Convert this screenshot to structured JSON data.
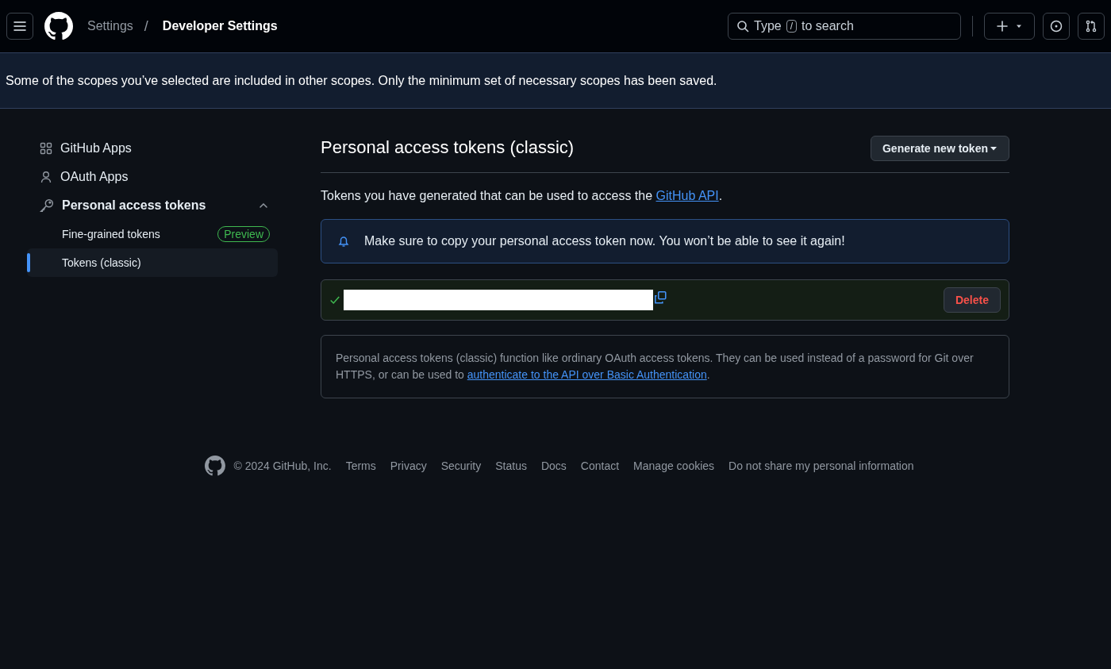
{
  "header": {
    "separator": "/",
    "breadcrumbs": [
      {
        "label": "Settings",
        "current": false
      },
      {
        "label": "Developer Settings",
        "current": true
      }
    ],
    "search": {
      "before": "Type",
      "key": "/",
      "after": "to search"
    }
  },
  "banner": {
    "text": "Some of the scopes you’ve selected are included in other scopes. Only the minimum set of necessary scopes has been saved."
  },
  "sidebar": {
    "items": [
      {
        "label": "GitHub Apps",
        "kind": "grid",
        "expanded": false
      },
      {
        "label": "OAuth Apps",
        "kind": "person",
        "expanded": false
      },
      {
        "label": "Personal access tokens",
        "kind": "key",
        "expanded": true,
        "children": [
          {
            "label": "Fine-grained tokens",
            "badge": "Preview",
            "selected": false
          },
          {
            "label": "Tokens (classic)",
            "selected": true
          }
        ]
      }
    ]
  },
  "main": {
    "title": "Personal access tokens (classic)",
    "generate_button": "Generate new token",
    "intro": {
      "before": "Tokens you have generated that can be used to access the ",
      "link": "GitHub API",
      "after": "."
    },
    "flash": "Make sure to copy your personal access token now. You won’t be able to see it again!",
    "token": {
      "delete_button": "Delete"
    },
    "note": {
      "before": "Personal access tokens (classic) function like ordinary OAuth access tokens. They can be used instead of a password for Git over HTTPS, or can be used to ",
      "link": "authenticate to the API over Basic Authentication",
      "after": "."
    }
  },
  "footer": {
    "copyright": "© 2024 GitHub, Inc.",
    "links": [
      "Terms",
      "Privacy",
      "Security",
      "Status",
      "Docs",
      "Contact",
      "Manage cookies",
      "Do not share my personal information"
    ]
  }
}
